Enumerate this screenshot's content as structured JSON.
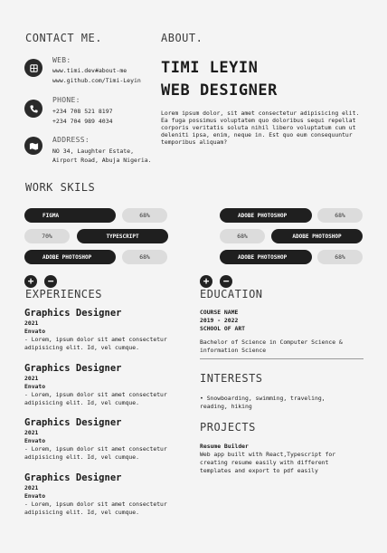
{
  "contact": {
    "title": "CONTACT ME.",
    "web": {
      "label": "WEB:",
      "lines": [
        "www.timi.dev#about-me",
        "www.github.com/Timi-Leyin"
      ]
    },
    "phone": {
      "label": "PHONE:",
      "lines": [
        "+234 708 521 8197",
        "+234 704 989 4034"
      ]
    },
    "address": {
      "label": "ADDRESS:",
      "lines": [
        "NO 34, Laughter Estate,",
        "Airport Road, Abuja Nigeria."
      ]
    }
  },
  "about": {
    "title": "ABOUT.",
    "name": "TIMI LEYIN",
    "role": "WEB DESIGNER",
    "text": "Lorem ipsum dolor, sit amet consectetur adipisicing elit. Ea fuga possimus voluptatem quo doloribus sequi repellat corporis veritatis soluta nihil libero voluptatum cum ut deleniti ipsa, enim, neque in. Est quo eum consequuntur temporibus aliquam?"
  },
  "skills": {
    "title": "WORK SKILS",
    "left": [
      {
        "name": "FIGMA",
        "value": "68%"
      },
      {
        "name": "TYPESCRIPT",
        "value": "70%"
      },
      {
        "name": "ADOBE PHOTOSHOP",
        "value": "68%"
      }
    ],
    "right": [
      {
        "name": "ADOBE PHOTOSHOP",
        "value": "68%"
      },
      {
        "name": "ADOBE PHOTOSHOP",
        "value": "68%"
      },
      {
        "name": "ADOBE PHOTOSHOP",
        "value": "68%"
      }
    ],
    "add": "+",
    "remove": "−"
  },
  "experiences": {
    "title": "EXPERIENCES",
    "items": [
      {
        "role": "Graphics Designer",
        "year": "2021",
        "company": "Envato",
        "desc": "- Lorem, ipsum dolor sit amet consectetur adipisicing elit. Id, vel cumque."
      },
      {
        "role": "Graphics Designer",
        "year": "2021",
        "company": "Envato",
        "desc": "- Lorem, ipsum dolor sit amet consectetur adipisicing elit. Id, vel cumque."
      },
      {
        "role": "Graphics Designer",
        "year": "2021",
        "company": "Envato",
        "desc": "- Lorem, ipsum dolor sit amet consectetur adipisicing elit. Id, vel cumque."
      },
      {
        "role": "Graphics Designer",
        "year": "2021",
        "company": "Envato",
        "desc": "- Lorem, ipsum dolor sit amet consectetur adipisicing elit. Id, vel cumque."
      }
    ]
  },
  "education": {
    "title": "EDUCATION",
    "course": "COURSE NAME",
    "years": "2019 - 2022",
    "school": "SCHOOL OF ART",
    "degree": "Bachelor of Science in Computer Science & information Science"
  },
  "interests": {
    "title": "INTERESTS",
    "text": "•  Snowboarding, swimming, traveling, reading, hiking"
  },
  "projects": {
    "title": "PROJECTS",
    "name": "Resume Builder",
    "desc": "Web app built with React,Typescript for creating resume easily with different templates and export to pdf easily"
  },
  "icons": {
    "web": "globe-icon",
    "phone": "phone-icon",
    "address": "map-icon"
  }
}
